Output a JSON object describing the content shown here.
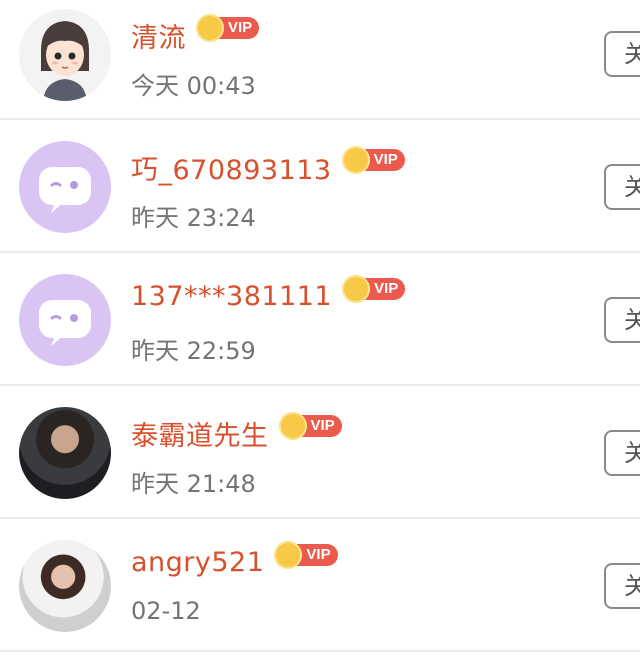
{
  "rows": [
    {
      "name": "清流",
      "vip": "VIP",
      "time": "今天 00:43",
      "follow": "关",
      "avatar": "cartoon-girl-avatar-icon"
    },
    {
      "name": "巧_670893113",
      "vip": "VIP",
      "time": "昨天 23:24",
      "follow": "关",
      "avatar": "default-chat-bubble-avatar-icon"
    },
    {
      "name": "137***381111",
      "vip": "VIP",
      "time": "昨天 22:59",
      "follow": "关",
      "avatar": "default-chat-bubble-avatar-icon"
    },
    {
      "name": "泰霸道先生",
      "vip": "VIP",
      "time": "昨天 21:48",
      "follow": "关",
      "avatar": "photo-avatar"
    },
    {
      "name": "angry521",
      "vip": "VIP",
      "time": "02-12",
      "follow": "关",
      "avatar": "photo-avatar"
    }
  ],
  "colors": {
    "name": "#d8502c",
    "vip_tag": "#ea5b4e",
    "vip_crown": "#f7c946",
    "default_avatar": "#d9c4f4"
  }
}
